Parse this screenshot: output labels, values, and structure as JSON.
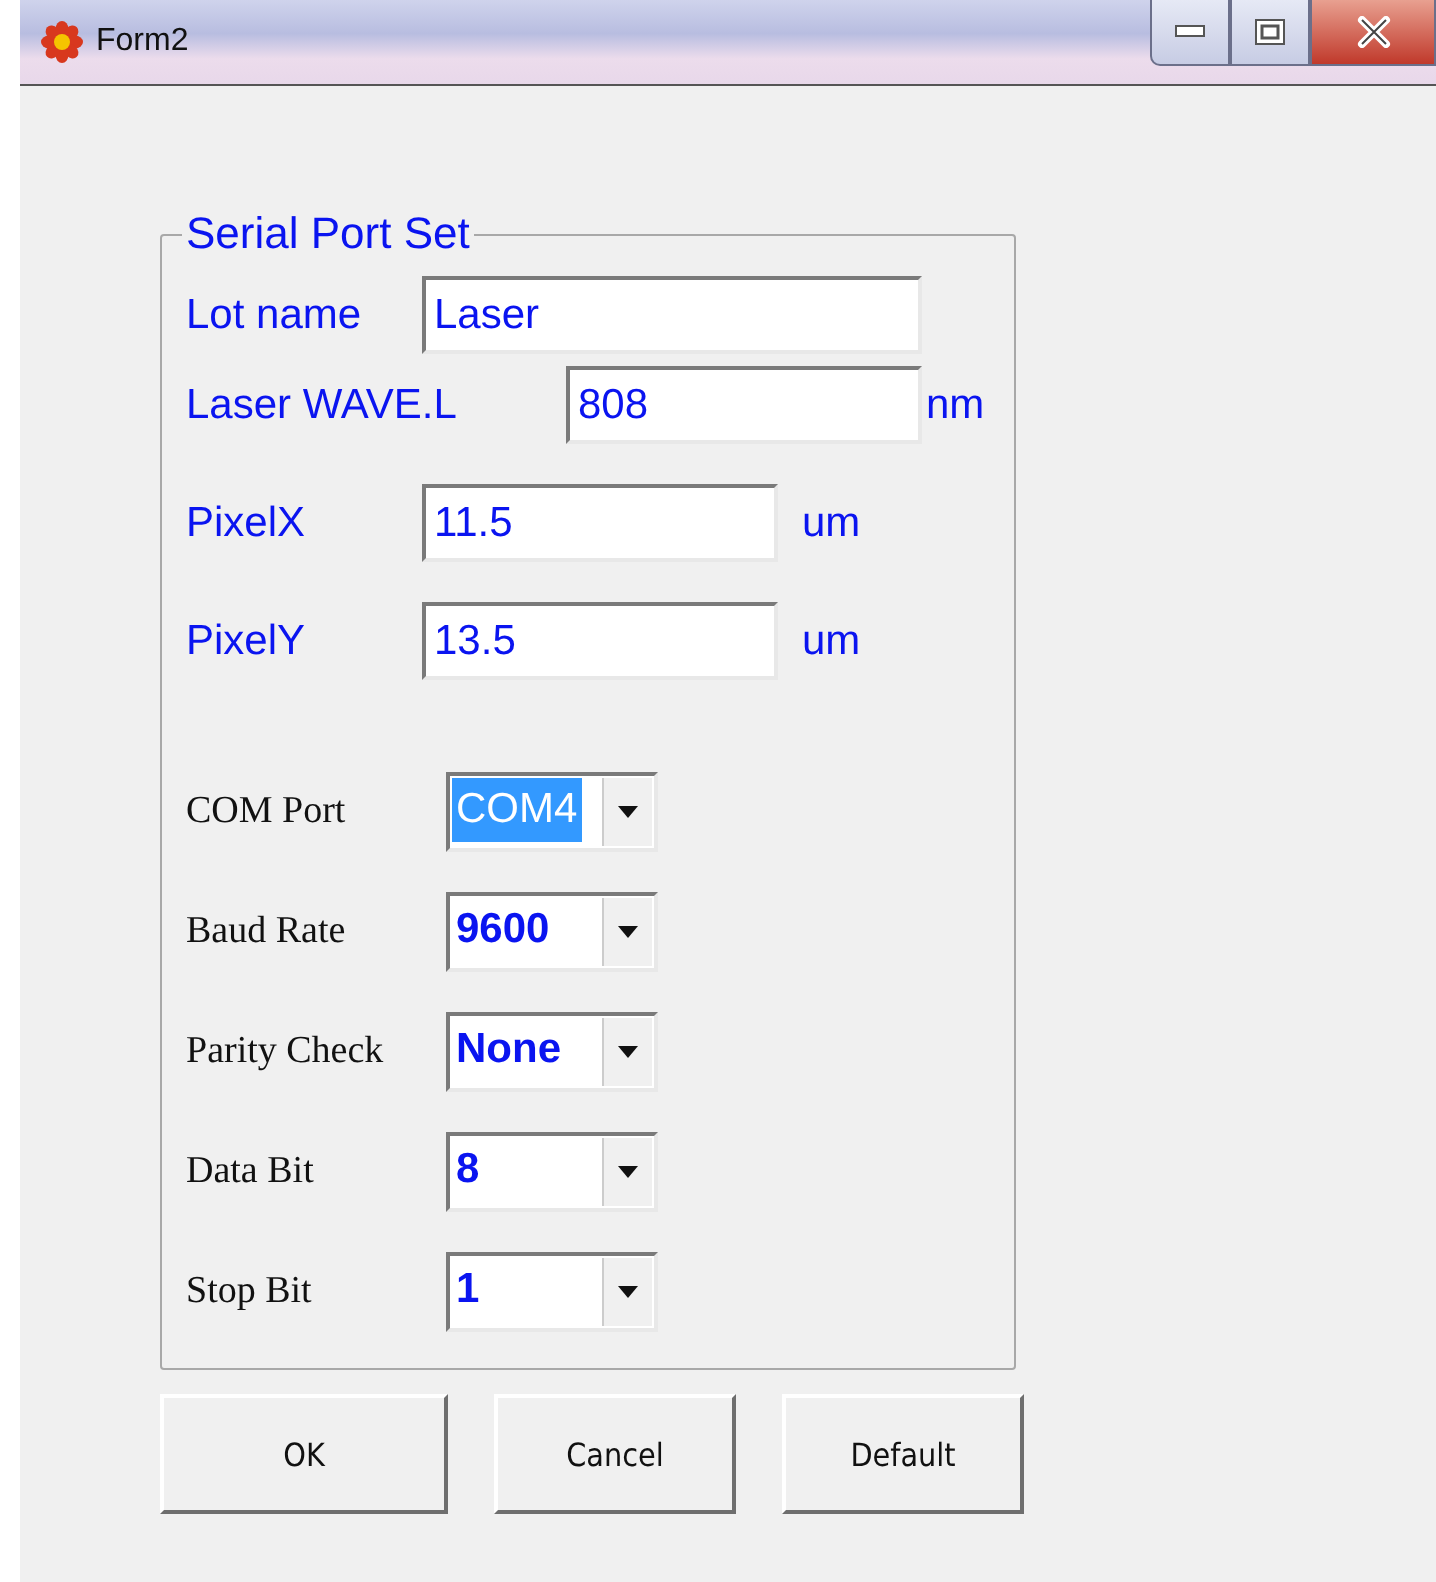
{
  "window": {
    "title": "Form2"
  },
  "group": {
    "title": "Serial Port Set",
    "text_fields": [
      {
        "label": "Lot name",
        "value": "Laser",
        "kind": "wide"
      },
      {
        "label": "Laser WAVE.L",
        "value": "808",
        "unit": "nm",
        "kind": "offset"
      },
      {
        "label": "PixelX",
        "value": "11.5",
        "unit": "um",
        "kind": "short"
      },
      {
        "label": "PixelY",
        "value": "13.5",
        "unit": "um",
        "kind": "short"
      }
    ],
    "combos": [
      {
        "label": "COM Port",
        "value": "COM4",
        "focused": true
      },
      {
        "label": "Baud Rate",
        "value": "9600",
        "focused": false
      },
      {
        "label": "Parity Check",
        "value": "None",
        "focused": false
      },
      {
        "label": "Data Bit",
        "value": "8",
        "focused": false
      },
      {
        "label": "Stop Bit",
        "value": "1",
        "focused": false
      }
    ]
  },
  "buttons": [
    "OK",
    "Cancel",
    "Default"
  ]
}
